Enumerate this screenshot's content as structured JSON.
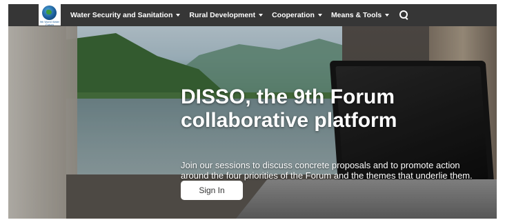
{
  "nav": {
    "logo_text": "9th World Water Forum",
    "items": [
      {
        "label": "Water Security and Sanitation"
      },
      {
        "label": "Rural Development"
      },
      {
        "label": "Cooperation"
      },
      {
        "label": "Means & Tools"
      }
    ],
    "search_icon": "search-icon"
  },
  "hero": {
    "title": "DISSO, the 9th Forum collaborative platform",
    "description": "Join our sessions to discuss concrete proposals and to promote action around the four priorities of the Forum and the themes that underlie them.",
    "signin_label": "Sign In"
  },
  "colors": {
    "nav_bg": "#363636",
    "nav_text": "#ffffff",
    "button_bg": "#ffffff"
  }
}
